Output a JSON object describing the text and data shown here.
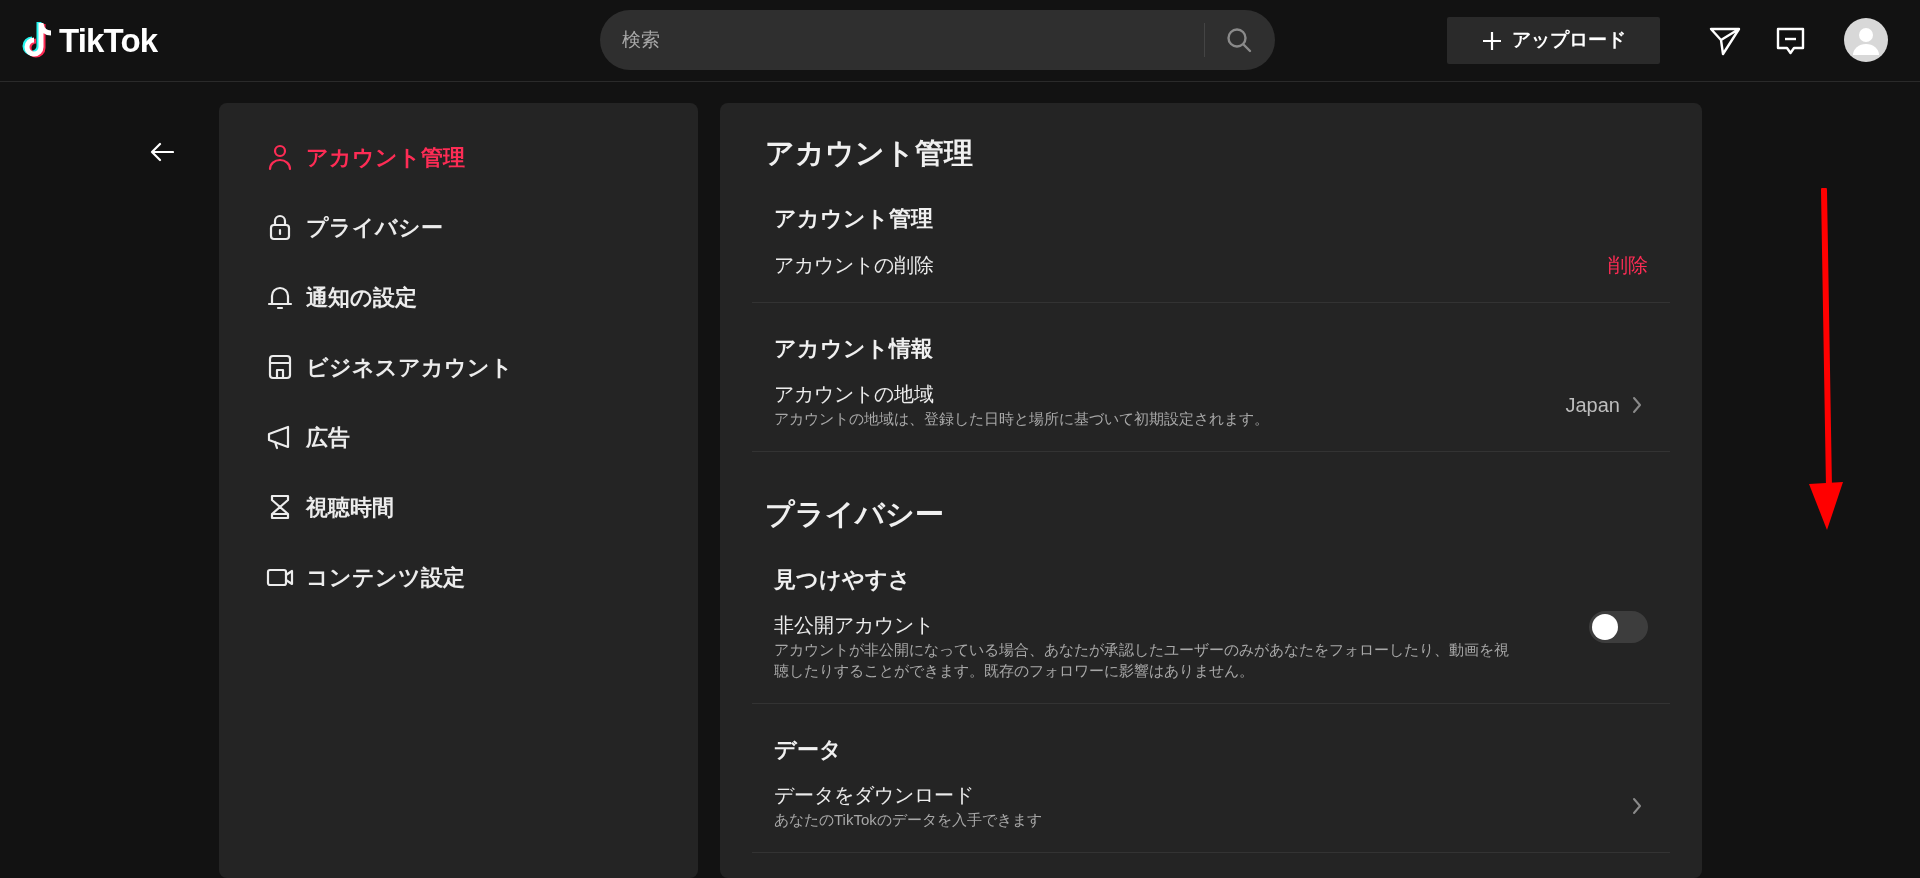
{
  "header": {
    "logo": "TikTok",
    "search": {
      "placeholder": "検索"
    },
    "upload_button": "アップロード"
  },
  "sidebar": {
    "items": [
      {
        "label": "アカウント管理",
        "selected": true
      },
      {
        "label": "プライバシー",
        "selected": false
      },
      {
        "label": "通知の設定",
        "selected": false
      },
      {
        "label": "ビジネスアカウント",
        "selected": false
      },
      {
        "label": "広告",
        "selected": false
      },
      {
        "label": "視聴時間",
        "selected": false
      },
      {
        "label": "コンテンツ設定",
        "selected": false
      }
    ]
  },
  "sections": [
    {
      "title": "アカウント管理",
      "groups": [
        {
          "heading": "アカウント管理",
          "rows": [
            {
              "kind": "action",
              "label": "アカウントの削除",
              "action": "削除"
            }
          ]
        },
        {
          "heading": "アカウント情報",
          "rows": [
            {
              "kind": "link",
              "label": "アカウントの地域",
              "description": "アカウントの地域は、登録した日時と場所に基づいて初期設定されます。",
              "value": "Japan"
            }
          ]
        }
      ]
    },
    {
      "title": "プライバシー",
      "groups": [
        {
          "heading": "見つけやすさ",
          "rows": [
            {
              "kind": "toggle",
              "label": "非公開アカウント",
              "description": "アカウントが非公開になっている場合、あなたが承認したユーザーのみがあなたをフォローしたり、動画を視聴したりすることができます。既存のフォロワーに影響はありません。",
              "on": false
            }
          ]
        },
        {
          "heading": "データ",
          "rows": [
            {
              "kind": "link",
              "label": "データをダウンロード",
              "description": "あなたのTikTokのデータを入手できます"
            }
          ]
        }
      ]
    }
  ]
}
